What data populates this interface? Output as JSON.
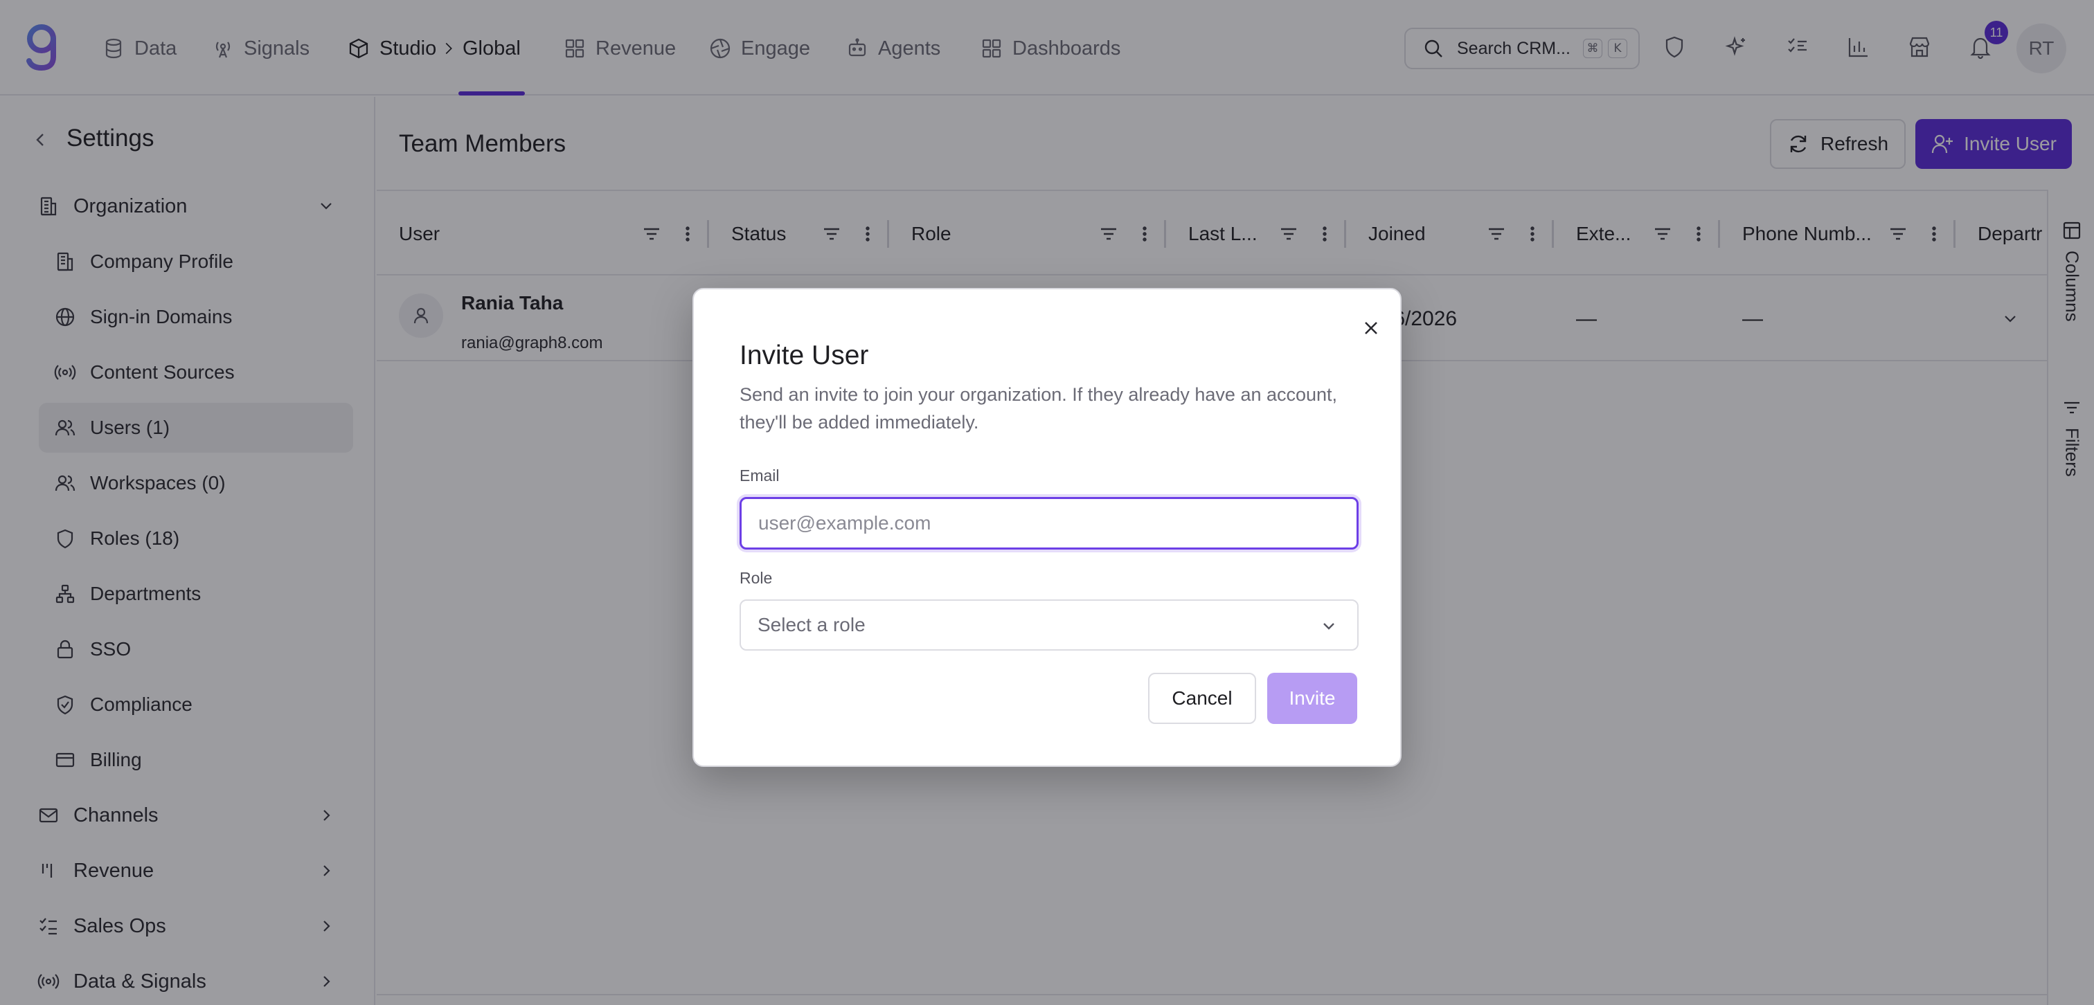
{
  "topnav": {
    "items": [
      {
        "label": "Data",
        "icon": "database-icon"
      },
      {
        "label": "Signals",
        "icon": "antenna-icon"
      },
      {
        "label": "Studio",
        "icon": "cube-icon"
      },
      {
        "label": "Global"
      },
      {
        "label": "Revenue",
        "icon": "grid-icon"
      },
      {
        "label": "Engage",
        "icon": "aperture-icon"
      },
      {
        "label": "Agents",
        "icon": "robot-icon"
      },
      {
        "label": "Dashboards",
        "icon": "dashboard-icon"
      }
    ],
    "search_label": "Search CRM...",
    "search_kbd": [
      "⌘",
      "K"
    ],
    "notification_count": "11",
    "user_initials": "RT",
    "accent_color": "#5b2bd9"
  },
  "sidebar": {
    "title": "Settings",
    "groups": [
      {
        "label": "Organization",
        "expanded": true
      },
      {
        "label": "Channels"
      },
      {
        "label": "Revenue"
      },
      {
        "label": "Sales Ops"
      },
      {
        "label": "Data & Signals"
      }
    ],
    "org_items": [
      {
        "label": "Company Profile",
        "icon": "building-icon"
      },
      {
        "label": "Sign-in Domains",
        "icon": "globe-icon"
      },
      {
        "label": "Content Sources",
        "icon": "broadcast-icon"
      },
      {
        "label": "Users (1)",
        "icon": "users-icon",
        "active": true
      },
      {
        "label": "Workspaces (0)",
        "icon": "workspaces-icon"
      },
      {
        "label": "Roles (18)",
        "icon": "shield-icon"
      },
      {
        "label": "Departments",
        "icon": "org-chart-icon"
      },
      {
        "label": "SSO",
        "icon": "lock-icon"
      },
      {
        "label": "Compliance",
        "icon": "shield-check-icon"
      },
      {
        "label": "Billing",
        "icon": "credit-card-icon"
      }
    ]
  },
  "main": {
    "title": "Team Members",
    "refresh_label": "Refresh",
    "invite_label": "Invite User",
    "columns": [
      "User",
      "Status",
      "Role",
      "Last L...",
      "Joined",
      "Exte...",
      "Phone Numb...",
      "Departr"
    ],
    "rows": [
      {
        "name": "Rania Taha",
        "email": "rania@graph8.com",
        "joined": "/6/2026",
        "external": "—",
        "phone": "—"
      }
    ],
    "rail": {
      "columns": "Columns",
      "filters": "Filters"
    }
  },
  "modal": {
    "title": "Invite User",
    "description": "Send an invite to join your organization. If they already have an account, they'll be added immediately.",
    "email_label": "Email",
    "email_value": "",
    "email_placeholder": "user@example.com",
    "role_label": "Role",
    "role_placeholder": "Select a role",
    "cancel_label": "Cancel",
    "invite_label": "Invite"
  }
}
